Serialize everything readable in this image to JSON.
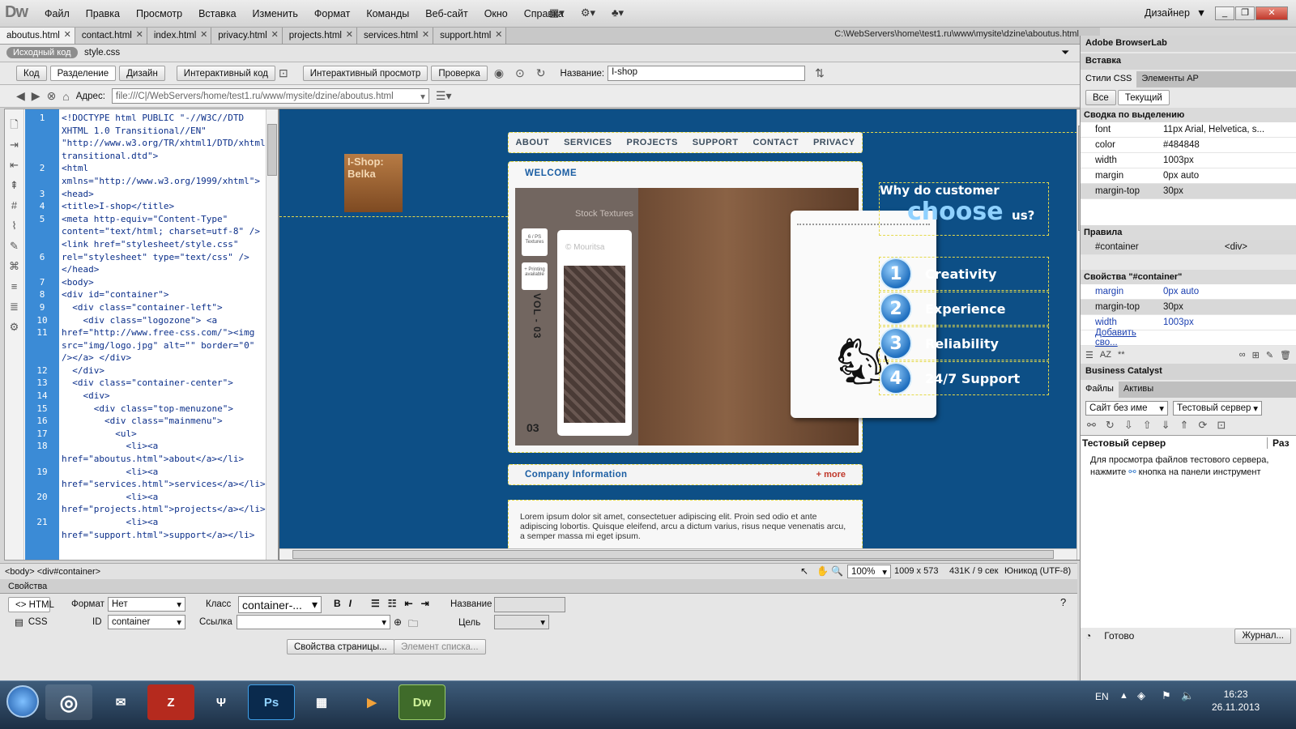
{
  "menubar": {
    "app_logo": "Dw",
    "menus": [
      "Файл",
      "Правка",
      "Просмотр",
      "Вставка",
      "Изменить",
      "Формат",
      "Команды",
      "Веб-сайт",
      "Окно",
      "Справка"
    ],
    "workspace": "Дизайнер"
  },
  "tabs": [
    "aboutus.html",
    "contact.html",
    "index.html",
    "privacy.html",
    "projects.html",
    "services.html",
    "support.html"
  ],
  "active_tab": "aboutus.html",
  "filepath": "C:\\WebServers\\home\\test1.ru\\www\\mysite\\dzine\\aboutus.html",
  "related_files": {
    "source": "Исходный код",
    "css": "style.css"
  },
  "doc_toolbar": {
    "view_code": "Код",
    "view_split": "Разделение",
    "view_design": "Дизайн",
    "live_code": "Интерактивный код",
    "live_view": "Интерактивный просмотр",
    "check": "Проверка",
    "title_label": "Название:",
    "title_value": "I-shop"
  },
  "address": {
    "label": "Адрес:",
    "value": "file:///C|/WebServers/home/test1.ru/www/mysite/dzine/aboutus.html"
  },
  "code": {
    "line_numbers": [
      "1",
      "",
      "",
      "",
      "2",
      "",
      "3",
      "4",
      "5",
      "",
      "",
      "6",
      "",
      "7",
      "8",
      "9",
      "10",
      "11",
      "",
      "",
      "12",
      "13",
      "14",
      "15",
      "16",
      "17",
      "18",
      "",
      "19",
      "",
      "20",
      "",
      "21",
      ""
    ],
    "text": "<!DOCTYPE html PUBLIC \"-//W3C//DTD XHTML 1.0 Transitional//EN\" \"http://www.w3.org/TR/xhtml1/DTD/xhtml1-transitional.dtd\">\n<html xmlns=\"http://www.w3.org/1999/xhtml\">\n<head>\n<title>I-shop</title>\n<meta http-equiv=\"Content-Type\" content=\"text/html; charset=utf-8\" />\n<link href=\"stylesheet/style.css\" rel=\"stylesheet\" type=\"text/css\" />\n</head>\n<body>\n<div id=\"container\">\n  <div class=\"container-left\">\n    <div class=\"logozone\"> <a href=\"http://www.free-css.com/\"><img src=\"img/logo.jpg\" alt=\"\" border=\"0\" /></a> </div>\n  </div>\n  <div class=\"container-center\">\n    <div>\n      <div class=\"top-menuzone\">\n        <div class=\"mainmenu\">\n          <ul>\n            <li><a href=\"aboutus.html\">about</a></li>\n            <li><a href=\"services.html\">services</a></li>\n            <li><a href=\"projects.html\">projects</a></li>\n            <li><a href=\"support.html\">support</a></li>"
  },
  "design": {
    "logo_text": "I-Shop:\nBelka",
    "menu": [
      "ABOUT",
      "SERVICES",
      "PROJECTS",
      "SUPPORT",
      "CONTACT",
      "PRIVACY"
    ],
    "welcome": "WELCOME",
    "mag_title": "Stock Textures",
    "mag_sub": "© Mouritsa",
    "mag_vol": "VOL - 03",
    "mag_num": "03",
    "mag_card1": "6 / PS Textures",
    "mag_card2": "+ Printing available",
    "why_line1": "Why do customer",
    "why_big": "choose",
    "why_small": "us?",
    "steps": [
      {
        "n": "1",
        "label": "Creativity"
      },
      {
        "n": "2",
        "label": "Experience"
      },
      {
        "n": "3",
        "label": "Reliability"
      },
      {
        "n": "4",
        "label": "24/7 Support"
      }
    ],
    "company": "Company Information",
    "more": "+ more",
    "lorem": "Lorem ipsum dolor sit amet, consectetuer adipiscing elit. Proin sed odio et ante adipiscing lobortis. Quisque eleifend, arcu a dictum varius, risus neque venenatis arcu, a semper massa mi eget ipsum.",
    "bg_color": "#0d4f86"
  },
  "statusbar": {
    "tags": "<body> <div#container>",
    "zoom": "100%",
    "size": "1009 x 573",
    "weight": "431K / 9 сек",
    "encoding": "Юникод (UTF-8)"
  },
  "properties": {
    "title": "Свойства",
    "html": "HTML",
    "css": "CSS",
    "format_label": "Формат",
    "format_value": "Нет",
    "class_label": "Класс",
    "class_value": "container-...",
    "id_label": "ID",
    "id_value": "container",
    "link_label": "Ссылка",
    "name_label": "Название",
    "target_label": "Цель",
    "page_props": "Свойства страницы...",
    "list_item": "Элемент списка..."
  },
  "rpanel": {
    "browserlab": "Adobe BrowserLab",
    "insert": "Вставка",
    "tab_css": "Стили CSS",
    "tab_ap": "Элементы AP",
    "btn_all": "Все",
    "btn_current": "Текущий",
    "summary_title": "Сводка по выделению",
    "summary": [
      {
        "k": "font",
        "v": "11px Arial, Helvetica, s..."
      },
      {
        "k": "color",
        "v": "#484848"
      },
      {
        "k": "width",
        "v": "1003px"
      },
      {
        "k": "margin",
        "v": "0px auto"
      },
      {
        "k": "margin-top",
        "v": "30px"
      }
    ],
    "rules_title": "Правила",
    "rule_sel": "#container",
    "rule_tag": "<div>",
    "props_title": "Свойства \"#container\"",
    "props": [
      {
        "k": "margin",
        "v": "0px auto"
      },
      {
        "k": "margin-top",
        "v": "30px"
      },
      {
        "k": "width",
        "v": "1003px"
      }
    ],
    "add_prop": "Добавить сво...",
    "business_catalyst": "Business Catalyst",
    "tab_files": "Файлы",
    "tab_assets": "Активы",
    "site_select": "Сайт без име",
    "server_select": "Тестовый сервер",
    "files_col1": "Тестовый сервер",
    "files_col2": "Раз",
    "files_msg1": "Для просмотра файлов тестового сервера,",
    "files_msg2a": "нажмите",
    "files_msg2b": "кнопка на панели инструмент",
    "status_ready": "Готово",
    "log_btn": "Журнал..."
  },
  "taskbar": {
    "lang": "EN",
    "time": "16:23",
    "date": "26.11.2013"
  }
}
